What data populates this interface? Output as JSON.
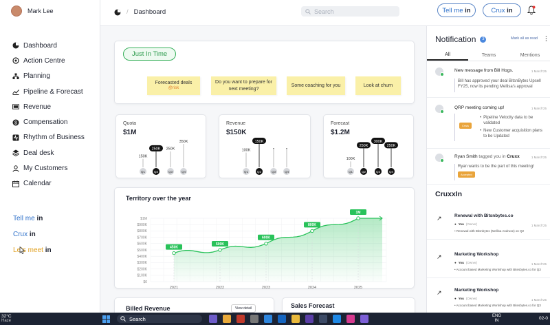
{
  "user": {
    "name": "Mark Lee"
  },
  "sidebar": {
    "items": [
      {
        "label": "Dashboard",
        "icon": "pie-icon"
      },
      {
        "label": "Action Centre",
        "icon": "target-icon"
      },
      {
        "label": "Planning",
        "icon": "planning-icon"
      },
      {
        "label": "Pipeline & Forecast",
        "icon": "trend-icon"
      },
      {
        "label": "Revenue",
        "icon": "revenue-icon"
      },
      {
        "label": "Compensation",
        "icon": "dollar-icon"
      },
      {
        "label": "Rhythm of Business",
        "icon": "rhythm-icon"
      },
      {
        "label": "Deal desk",
        "icon": "layers-icon"
      },
      {
        "label": "My Customers",
        "icon": "person-icon"
      },
      {
        "label": "Calendar",
        "icon": "calendar-icon"
      }
    ],
    "links": [
      {
        "main": "Tell me",
        "suffix": "in"
      },
      {
        "main": "Crux",
        "suffix": "in"
      },
      {
        "main": "Lets meet",
        "suffix": "in"
      }
    ]
  },
  "topbar": {
    "breadcrumb": "Dashboard",
    "search_placeholder": "Search",
    "tellme": {
      "main": "Tell me",
      "suffix": "in"
    },
    "cruxx": {
      "main": "Crux",
      "suffix": "in"
    }
  },
  "jit": {
    "title": "Just In Time",
    "notes": [
      {
        "text": "Forecasted deals",
        "tag": "@risk"
      },
      {
        "text": "Do you want to prepare for next meeting?",
        "tag": ""
      },
      {
        "text": "Some coaching for you",
        "tag": ""
      },
      {
        "text": "Look at churn",
        "tag": ""
      }
    ]
  },
  "metrics": [
    {
      "label": "Quota",
      "value": "$1M",
      "bars": [
        {
          "q": "Q1",
          "v": "150K"
        },
        {
          "q": "Q2",
          "v": "250K"
        },
        {
          "q": "Q3",
          "v": "250K"
        },
        {
          "q": "Q4",
          "v": "350K"
        }
      ],
      "active": 1
    },
    {
      "label": "Revenue",
      "value": "$150K",
      "bars": [
        {
          "q": "Q1",
          "v": "100K"
        },
        {
          "q": "Q2",
          "v": "150K"
        },
        {
          "q": "Q3",
          "v": ""
        },
        {
          "q": "Q4",
          "v": ""
        }
      ],
      "active": 1
    },
    {
      "label": "Forecast",
      "value": "$1.2M",
      "bars": [
        {
          "q": "Q1",
          "v": "100K"
        },
        {
          "q": "Q2",
          "v": "250K"
        },
        {
          "q": "Q3",
          "v": "300K"
        },
        {
          "q": "Q4",
          "v": "250K"
        }
      ],
      "active": 3
    }
  ],
  "chart_data": {
    "type": "area",
    "title": "Territory over the year",
    "x": [
      "2021",
      "2022",
      "2023",
      "2024",
      "2025"
    ],
    "y_ticks": [
      "$0",
      "$100K",
      "$200K",
      "$300K",
      "$400K",
      "$500K",
      "$600K",
      "$700K",
      "$800K",
      "$900K",
      "$1M"
    ],
    "ylim": [
      0,
      1000
    ],
    "series": [
      {
        "values": [
          450,
          500,
          600,
          800,
          1000
        ]
      }
    ],
    "data_labels": [
      "450K",
      "500K",
      "600K",
      "800K",
      "1M"
    ],
    "grid": true,
    "color": "#29c25a"
  },
  "bottom_cards": {
    "billed": "Billed Revenue",
    "view_detail": "View detail",
    "sales": "Sales Forecast"
  },
  "notifications": {
    "title": "Notification",
    "count": "3",
    "mark_read": "Mark all as read",
    "tabs": [
      "All",
      "Teams",
      "Mentions"
    ],
    "items": [
      {
        "title": "New message from Bill Hogs.",
        "time": "1 March'25",
        "body": "Bill has approved your deal BitsnBytes Upsell FY25, now its pending Mellisa's approval"
      },
      {
        "title": "QRP meeting coming up!",
        "time": "1 March'25",
        "badge": "Crisis",
        "bullets": [
          "Pipeline Velocity data to be validated",
          "New Customer acquisition plans to be Updated"
        ]
      },
      {
        "title_prefix": "Ryan Smith",
        "title_mid": " tagged you in ",
        "title_bold": "Cruxx",
        "time": "1 March'25",
        "body": "Ryan wants to be the part of this meeting!",
        "badge": "Accepted"
      }
    ]
  },
  "cruxxin": {
    "title": "CruxxIn",
    "items": [
      {
        "title": "Renewal with Bitsnbytes.co",
        "you": "You",
        "you_tag": "(Owner)",
        "time": "1 March'25",
        "desc": "Renewal with Bitsnbytes (Mellisa Andruse) on Q2"
      },
      {
        "title": "Marketing Workshop",
        "you": "You",
        "you_tag": "(Owner)",
        "time": "1 March'25",
        "desc": "Account based Marketing Workshop with Bitesbytes.co for Q3"
      },
      {
        "title": "Marketing Workshop",
        "you": "You",
        "you_tag": "(Owner)",
        "time": "1 March'25",
        "desc": "Account based Marketing Workshop with Bitesbytes.co for Q3"
      }
    ]
  },
  "taskbar": {
    "weather": "32°C",
    "weather_sub": "Haze",
    "search": "Search",
    "lang": "ENG",
    "lang_sub": "IN",
    "clock": "02-0"
  }
}
